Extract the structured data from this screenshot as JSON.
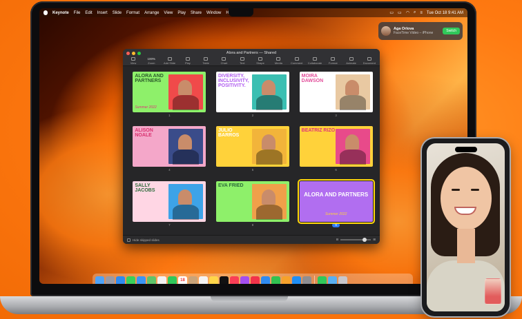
{
  "menubar": {
    "app": "Keynote",
    "menus": [
      "File",
      "Edit",
      "Insert",
      "Slide",
      "Format",
      "Arrange",
      "View",
      "Play",
      "Share",
      "Window",
      "Help"
    ],
    "clock": "Tue Oct 18  9:41 AM"
  },
  "notification": {
    "name": "Aga Orlova",
    "subtitle": "FaceTime Video – iPhone",
    "button": "Switch"
  },
  "window": {
    "title": "Alora and Partners — Shared",
    "toolbar": [
      {
        "label": "View",
        "icon": "sidebar-icon"
      },
      {
        "label": "Zoom",
        "value": "100%",
        "icon": "zoom-icon"
      },
      {
        "label": "Add Slide",
        "icon": "add-slide-icon"
      },
      {
        "label": "Play",
        "icon": "play-icon"
      },
      {
        "label": "Table",
        "icon": "table-icon"
      },
      {
        "label": "Chart",
        "icon": "chart-icon"
      },
      {
        "label": "Text",
        "icon": "text-icon"
      },
      {
        "label": "Shape",
        "icon": "shape-icon"
      },
      {
        "label": "Media",
        "icon": "media-icon"
      },
      {
        "label": "Comment",
        "icon": "comment-icon"
      },
      {
        "label": "Collaborate",
        "icon": "collaborate-icon"
      },
      {
        "label": "Format",
        "icon": "format-icon"
      },
      {
        "label": "Animate",
        "icon": "animate-icon"
      },
      {
        "label": "Document",
        "icon": "document-icon"
      }
    ],
    "footer": {
      "checkbox_label": "Hide skipped slides"
    },
    "slides": [
      {
        "num": "1",
        "title": "ALORA AND PARTNERS",
        "subtitle": "Summer 2022",
        "bg": "#8ef06a",
        "text_color": "#2b5a2b",
        "photo": "#f04a4a"
      },
      {
        "num": "2",
        "title": "DIVERSITY, INCLUSIVITY, POSITIVITY.",
        "subtitle": "",
        "bg": "#ffffff",
        "text_color": "#b05cf0",
        "photo": "#3bbfb2"
      },
      {
        "num": "3",
        "title": "MOIRA DAWSON",
        "subtitle": "",
        "bg": "#ffffff",
        "text_color": "#e24d9a",
        "photo": "#e9c9a2"
      },
      {
        "num": "4",
        "title": "ALISON NOALE",
        "subtitle": "",
        "bg": "#f4a7c9",
        "text_color": "#d9306f",
        "photo": "#3a4c8a"
      },
      {
        "num": "5",
        "title": "JULIO BARROS",
        "subtitle": "",
        "bg": "#ffd23a",
        "text_color": "#ffffff",
        "photo": "#f2b43a"
      },
      {
        "num": "6",
        "title": "BEATRIZ RIZO",
        "subtitle": "",
        "bg": "#ffd23a",
        "text_color": "#e0347a",
        "photo": "#e84a8a"
      },
      {
        "num": "7",
        "title": "SALLY JACOBS",
        "subtitle": "",
        "bg": "#ffd6e4",
        "text_color": "#2b6a3a",
        "photo": "#3da3e8"
      },
      {
        "num": "8",
        "title": "EVA FRIED",
        "subtitle": "",
        "bg": "#8ef06a",
        "text_color": "#2b6a3a",
        "photo": "#f0a04a"
      },
      {
        "num": "9",
        "title": "ALORA AND PARTNERS",
        "subtitle": "Summer 2022",
        "bg": "#b16ef0",
        "text_color": "#ffffff",
        "photo": ""
      }
    ],
    "selected_slide": "9"
  },
  "dock": {
    "apps": [
      {
        "name": "finder-icon",
        "color": "#4fa3f7"
      },
      {
        "name": "launchpad-icon",
        "color": "#9a9aa6"
      },
      {
        "name": "safari-icon",
        "color": "#2f8bf0"
      },
      {
        "name": "messages-icon",
        "color": "#39d05a"
      },
      {
        "name": "mail-icon",
        "color": "#3b95f5"
      },
      {
        "name": "maps-icon",
        "color": "#5fc46a"
      },
      {
        "name": "photos-icon",
        "color": "#f2f2f2"
      },
      {
        "name": "facetime-icon",
        "color": "#30c85a"
      },
      {
        "name": "calendar-icon",
        "color": "#ffffff",
        "text": "18"
      },
      {
        "name": "contacts-icon",
        "color": "#c9a47a"
      },
      {
        "name": "reminders-icon",
        "color": "#f4f4f4"
      },
      {
        "name": "notes-icon",
        "color": "#ffd64a"
      },
      {
        "name": "tv-icon",
        "color": "#111111"
      },
      {
        "name": "music-icon",
        "color": "#fa3e56"
      },
      {
        "name": "podcasts-icon",
        "color": "#a34ef0"
      },
      {
        "name": "news-icon",
        "color": "#f3334a"
      },
      {
        "name": "keynote-icon",
        "color": "#2f8bf0"
      },
      {
        "name": "numbers-icon",
        "color": "#31c251"
      },
      {
        "name": "pages-icon",
        "color": "#f6a22b"
      },
      {
        "name": "app-store-icon",
        "color": "#1f8ef4"
      },
      {
        "name": "settings-icon",
        "color": "#8e8e93"
      },
      {
        "name": "facetime-active-icon",
        "color": "#30c85a"
      },
      {
        "name": "downloads-folder-icon",
        "color": "#5ab0f2"
      },
      {
        "name": "trash-icon",
        "color": "#c7c7cc"
      }
    ]
  }
}
